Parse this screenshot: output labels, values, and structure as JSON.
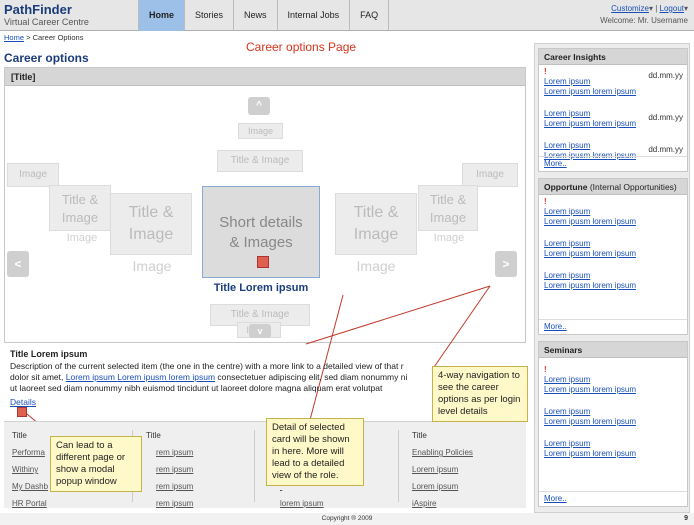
{
  "header": {
    "logo_title": "PathFinder",
    "logo_subtitle": "Virtual Career Centre",
    "tabs": [
      {
        "label": "Home",
        "active": true
      },
      {
        "label": "Stories",
        "active": false
      },
      {
        "label": "News",
        "active": false
      },
      {
        "label": "Internal Jobs",
        "active": false
      },
      {
        "label": "FAQ",
        "active": false
      }
    ],
    "customize": "Customize",
    "customize_arrow": "▾",
    "divider": "|",
    "logout": "Logout",
    "logout_arrow": "▾",
    "welcome": "Welcome: Mr. Username"
  },
  "breadcrumb": {
    "home": "Home",
    "sep": ">",
    "current": "Career Options"
  },
  "page_note": "Career options Page",
  "page_title": "Career options",
  "panel": {
    "header": "[Title]",
    "up_arrow": "^",
    "down_arrow": "v",
    "left_arrow": "<",
    "right_arrow": ">",
    "image": "Image",
    "title_image": "Title & Image",
    "title_line": "Title &",
    "image_line": "Image",
    "center_line1": "Short details",
    "center_line2": "& Images",
    "center_title": "Title Lorem ipsum"
  },
  "description": {
    "title": "Title Lorem ipsum",
    "text1": "Description of the current selected item (the one in the centre) with a more link to a detailed view of that r",
    "text2a": "dolor sit amet,",
    "text2link": "Lorem ipsum Lorem ipusm lorem ipsum",
    "text2b": "consectetuer adipiscing elit, sed diam nonummy ni",
    "text3": "ut laoreet sed diam nonummy nibh euismod tincidunt ut laoreet dolore magna aliquam erat volutpat",
    "details": "Details"
  },
  "footer_cols": [
    {
      "title": "Title",
      "links": [
        "Performa",
        "Withiny",
        "My Dashb",
        "HR Portal"
      ]
    },
    {
      "title": "Title",
      "links": [
        "rem ipsum",
        "rem ipsum",
        "rem ipsum",
        "rem ipsum"
      ]
    },
    {
      "title": "",
      "links": [
        "",
        "",
        "",
        "lorem ipsum"
      ]
    },
    {
      "title": "Title",
      "links": [
        "Enabling Policies",
        "Lorem ipsum",
        "Lorem ipsum",
        "iAspire"
      ]
    }
  ],
  "callouts": {
    "nav": "4-way navigation to see the career options as per login level details",
    "page": "Can lead to a different page or show a modal popup window",
    "detail": "Detail of selected card will be shown in here. More will lead to a detailed view of the role."
  },
  "sidebar": {
    "insights": {
      "title": "Career Insights",
      "items": [
        {
          "prefix": "!",
          "l1": "Lorem ipsum",
          "l2": "Lorem ipusm lorem ipsum",
          "date": "dd.mm.yy"
        },
        {
          "prefix": "",
          "l1": "Lorem ipsum",
          "l2": "Lorem ipusm lorem ipsum",
          "date": "dd.mm.yy"
        },
        {
          "prefix": "",
          "l1": "Lorem ipsum",
          "l2": "Lorem ipusm lorem ipsum",
          "date": "dd.mm.yy"
        }
      ],
      "more": "More.."
    },
    "opportune": {
      "title": "Opportune",
      "subtitle": "(Internal Opportunities)",
      "items": [
        {
          "prefix": "!",
          "l1": "Lorem ipsum",
          "l2": "Lorem ipusm lorem ipsum"
        },
        {
          "prefix": "",
          "l1": "Lorem ipsum",
          "l2": "Lorem ipusm lorem ipsum"
        },
        {
          "prefix": "",
          "l1": "Lorem ipsum",
          "l2": "Lorem ipusm lorem ipsum"
        }
      ],
      "more": "More.."
    },
    "seminars": {
      "title": "Seminars",
      "items": [
        {
          "prefix": "!",
          "l1": "Lorem ipsum",
          "l2": "Lorem ipusm lorem ipsum"
        },
        {
          "prefix": "",
          "l1": "Lorem ipsum",
          "l2": "Lorem ipusm lorem ipsum"
        },
        {
          "prefix": "",
          "l1": "Lorem ipsum",
          "l2": "Lorem ipusm lorem ipsum"
        }
      ],
      "more": "More.."
    }
  },
  "footer": {
    "copyright": "Copyright ® 2009",
    "page_number": "9"
  }
}
